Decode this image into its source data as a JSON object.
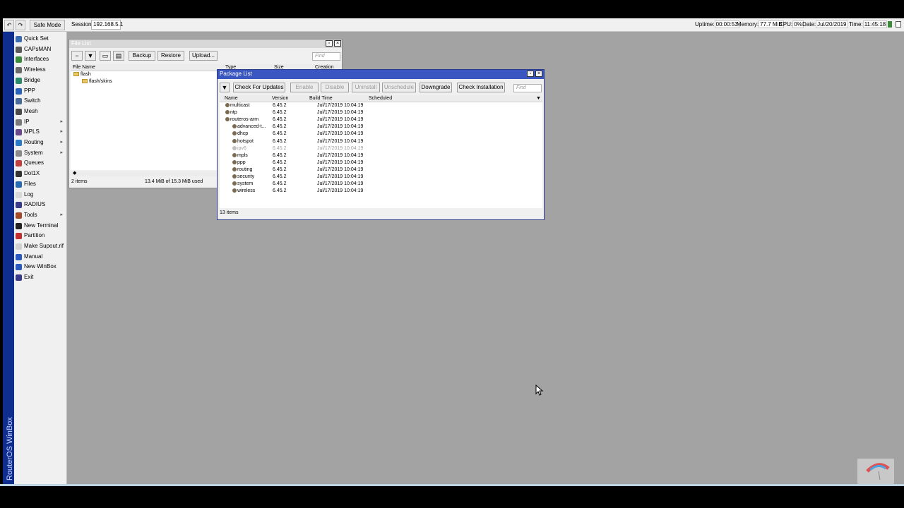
{
  "topbar": {
    "undo": "↶",
    "redo": "↷",
    "safe_mode": "Safe Mode",
    "session_label": "Session:",
    "session_value": "192.168.5.1",
    "uptime_label": "Uptime:",
    "uptime_value": "00:00:53",
    "memory_label": "Memory:",
    "memory_value": "77.7 MiB",
    "cpu_label": "CPU:",
    "cpu_value": "0%",
    "date_label": "Date:",
    "date_value": "Jul/20/2019",
    "time_label": "Time:",
    "time_value": "11:45:18"
  },
  "brand": "RouterOS WinBox",
  "sidebar": {
    "items": [
      {
        "label": "Quick Set",
        "icon": "quick-set-icon",
        "color": "#3a6ab0",
        "submenu": false
      },
      {
        "label": "CAPsMAN",
        "icon": "capsman-icon",
        "color": "#5a5a5a",
        "submenu": false
      },
      {
        "label": "Interfaces",
        "icon": "interfaces-icon",
        "color": "#3c8a3c",
        "submenu": false
      },
      {
        "label": "Wireless",
        "icon": "wireless-icon",
        "color": "#6a6a6a",
        "submenu": false
      },
      {
        "label": "Bridge",
        "icon": "bridge-icon",
        "color": "#2a8a6a",
        "submenu": false
      },
      {
        "label": "PPP",
        "icon": "ppp-icon",
        "color": "#2a62b8",
        "submenu": false
      },
      {
        "label": "Switch",
        "icon": "switch-icon",
        "color": "#4a6a9a",
        "submenu": false
      },
      {
        "label": "Mesh",
        "icon": "mesh-icon",
        "color": "#4a4a4a",
        "submenu": false
      },
      {
        "label": "IP",
        "icon": "ip-icon",
        "color": "#7a7a7a",
        "submenu": true
      },
      {
        "label": "MPLS",
        "icon": "mpls-icon",
        "color": "#6a4a8a",
        "submenu": true
      },
      {
        "label": "Routing",
        "icon": "routing-icon",
        "color": "#2a7ac8",
        "submenu": true
      },
      {
        "label": "System",
        "icon": "system-icon",
        "color": "#8a8a8a",
        "submenu": true
      },
      {
        "label": "Queues",
        "icon": "queues-icon",
        "color": "#c04040",
        "submenu": false
      },
      {
        "label": "Dot1X",
        "icon": "dot1x-icon",
        "color": "#333333",
        "submenu": false
      },
      {
        "label": "Files",
        "icon": "files-icon",
        "color": "#2a6ab0",
        "submenu": false
      },
      {
        "label": "Log",
        "icon": "log-icon",
        "color": "#d8d8d8",
        "submenu": false
      },
      {
        "label": "RADIUS",
        "icon": "radius-icon",
        "color": "#3a3a8a",
        "submenu": false
      },
      {
        "label": "Tools",
        "icon": "tools-icon",
        "color": "#a04a2a",
        "submenu": true
      },
      {
        "label": "New Terminal",
        "icon": "terminal-icon",
        "color": "#222222",
        "submenu": false
      },
      {
        "label": "Partition",
        "icon": "partition-icon",
        "color": "#c03030",
        "submenu": false
      },
      {
        "label": "Make Supout.rif",
        "icon": "supout-icon",
        "color": "#d0d0d0",
        "submenu": false
      },
      {
        "label": "Manual",
        "icon": "manual-icon",
        "color": "#2a5ac0",
        "submenu": false
      },
      {
        "label": "New WinBox",
        "icon": "winbox-icon",
        "color": "#2a5ac0",
        "submenu": false
      },
      {
        "label": "Exit",
        "icon": "exit-icon",
        "color": "#3a3a8a",
        "submenu": false
      }
    ]
  },
  "file_list": {
    "title": "File List",
    "buttons": {
      "backup": "Backup",
      "restore": "Restore",
      "upload": "Upload..."
    },
    "find_placeholder": "Find",
    "columns": [
      "File Name",
      "Type",
      "Size",
      "Creation"
    ],
    "rows": [
      {
        "name": "flash",
        "indent": 0
      },
      {
        "name": "flash/skins",
        "indent": 1
      }
    ],
    "status_count": "2 items",
    "status_usage": "13.4 MiB of 15.3 MiB used"
  },
  "package_list": {
    "title": "Package List",
    "buttons": {
      "check_updates": "Check For Updates",
      "enable": "Enable",
      "disable": "Disable",
      "uninstall": "Uninstall",
      "unschedule": "Unschedule",
      "downgrade": "Downgrade",
      "check_installation": "Check Installation"
    },
    "find_placeholder": "Find",
    "columns": [
      "Name",
      "Version",
      "Build Time",
      "Scheduled"
    ],
    "rows": [
      {
        "name": "multicast",
        "version": "6.45.2",
        "build": "Jul/17/2019 10:04:19",
        "indent": 0,
        "disabled": false
      },
      {
        "name": "ntp",
        "version": "6.45.2",
        "build": "Jul/17/2019 10:04:19",
        "indent": 0,
        "disabled": false
      },
      {
        "name": "routeros-arm",
        "version": "6.45.2",
        "build": "Jul/17/2019 10:04:19",
        "indent": 0,
        "disabled": false
      },
      {
        "name": "advanced-t...",
        "version": "6.45.2",
        "build": "Jul/17/2019 10:04:19",
        "indent": 1,
        "disabled": false
      },
      {
        "name": "dhcp",
        "version": "6.45.2",
        "build": "Jul/17/2019 10:04:19",
        "indent": 1,
        "disabled": false
      },
      {
        "name": "hotspot",
        "version": "6.45.2",
        "build": "Jul/17/2019 10:04:19",
        "indent": 1,
        "disabled": false
      },
      {
        "name": "ipv6",
        "version": "6.45.2",
        "build": "Jul/17/2019 10:04:19",
        "indent": 1,
        "disabled": true
      },
      {
        "name": "mpls",
        "version": "6.45.2",
        "build": "Jul/17/2019 10:04:19",
        "indent": 1,
        "disabled": false
      },
      {
        "name": "ppp",
        "version": "6.45.2",
        "build": "Jul/17/2019 10:04:19",
        "indent": 1,
        "disabled": false
      },
      {
        "name": "routing",
        "version": "6.45.2",
        "build": "Jul/17/2019 10:04:19",
        "indent": 1,
        "disabled": false
      },
      {
        "name": "security",
        "version": "6.45.2",
        "build": "Jul/17/2019 10:04:19",
        "indent": 1,
        "disabled": false
      },
      {
        "name": "system",
        "version": "6.45.2",
        "build": "Jul/17/2019 10:04:19",
        "indent": 1,
        "disabled": false
      },
      {
        "name": "wireless",
        "version": "6.45.2",
        "build": "Jul/17/2019 10:04:19",
        "indent": 1,
        "disabled": false
      }
    ],
    "status_count": "13 items"
  },
  "colors": {
    "desktop": "#a3a3a3",
    "brand_bar": "#0e2d8e",
    "active_title": "#3a56c0",
    "inactive_title": "#d8d8d8"
  }
}
